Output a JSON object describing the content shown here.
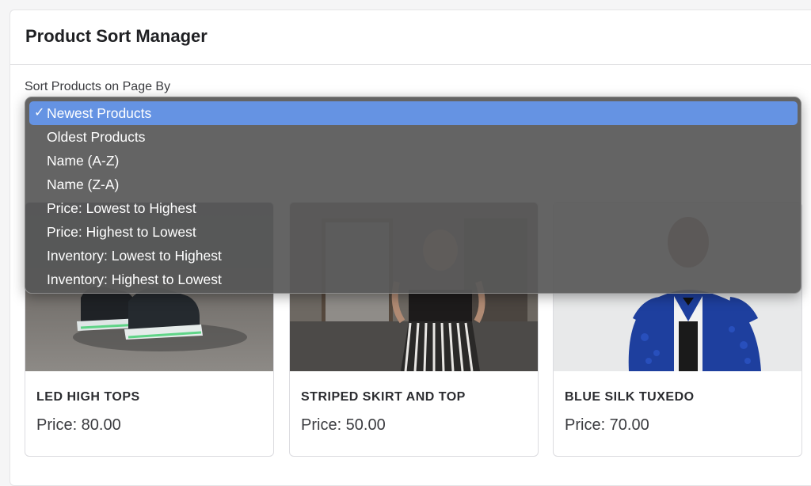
{
  "header": {
    "title": "Product Sort Manager"
  },
  "sort": {
    "label": "Sort Products on Page By",
    "selected": "Newest Products",
    "options": [
      {
        "label": "Newest Products",
        "selected": true
      },
      {
        "label": "Oldest Products",
        "selected": false
      },
      {
        "label": "Name (A-Z)",
        "selected": false
      },
      {
        "label": "Name (Z-A)",
        "selected": false
      },
      {
        "label": "Price: Lowest to Highest",
        "selected": false
      },
      {
        "label": "Price: Highest to Lowest",
        "selected": false
      },
      {
        "label": "Inventory: Lowest to Highest",
        "selected": false
      },
      {
        "label": "Inventory: Highest to Lowest",
        "selected": false
      }
    ],
    "check_glyph": "✓"
  },
  "products": [
    {
      "name": "LED HIGH TOPS",
      "price": "Price: 80.00",
      "image": "sneakers-photo"
    },
    {
      "name": "STRIPED SKIRT AND TOP",
      "price": "Price: 50.00",
      "image": "striped-skirt-photo"
    },
    {
      "name": "BLUE SILK TUXEDO",
      "price": "Price: 70.00",
      "image": "blue-tuxedo-photo"
    }
  ],
  "colors": {
    "accent": "#6593e3",
    "dropdown_bg": "#585858"
  }
}
